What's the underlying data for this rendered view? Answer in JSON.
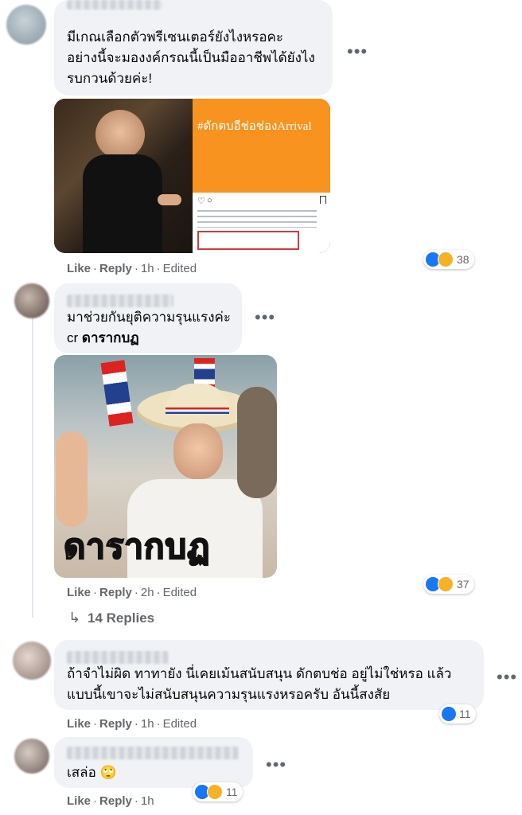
{
  "comments": [
    {
      "author": "Nama Polehoa",
      "text": "มีเกณเลือกตัวพรีเซนเตอร์ยังไงหรอคะ\nอย่างนี้จะมองงค์กรณนี้เป็นมืออาชีพได้ยังไง\nรบกวนด้วยค่ะ!",
      "image_caption": "#ดักตบอีช่อช่องArrival",
      "actions": {
        "like": "Like",
        "reply": "Reply",
        "time": "1h",
        "edited": "Edited"
      },
      "reaction_count": "38"
    },
    {
      "author": "",
      "text_line1": "มาช่วยกันยุติความรุนแรงค่ะ",
      "text_cr": "cr",
      "text_bold": "ดารากบฏ",
      "image_caption": "ดารากบฏ",
      "actions": {
        "like": "Like",
        "reply": "Reply",
        "time": "2h",
        "edited": "Edited"
      },
      "reaction_count": "37",
      "replies_label": "14 Replies"
    },
    {
      "author": "",
      "text": "ถ้าจำไม่ผิด ทาทายัง นี่เคยเม้นสนับสนุน ดักตบช่อ อยู่ไม่ใช่หรอ แล้ว\nแบบนี้เขาจะไม่สนับสนุนความรุนแรงหรอครับ อันนี้สงสัย",
      "actions": {
        "like": "Like",
        "reply": "Reply",
        "time": "1h",
        "edited": "Edited"
      },
      "reaction_count": "11"
    },
    {
      "author": "",
      "text": "เสล่อ",
      "emoji": "🙄",
      "actions": {
        "like": "Like",
        "reply": "Reply",
        "time": "1h"
      },
      "reaction_count": "11"
    }
  ],
  "colors": {
    "like_blue": "#1877f2",
    "haha_yellow": "#f7b125",
    "bubble": "#f0f2f5",
    "meta_gray": "#65676b"
  },
  "icons": [
    "like-icon",
    "haha-icon",
    "more-icon",
    "reply-arrow-icon",
    "instagram-heart-icon",
    "instagram-comment-icon",
    "instagram-bookmark-icon"
  ]
}
